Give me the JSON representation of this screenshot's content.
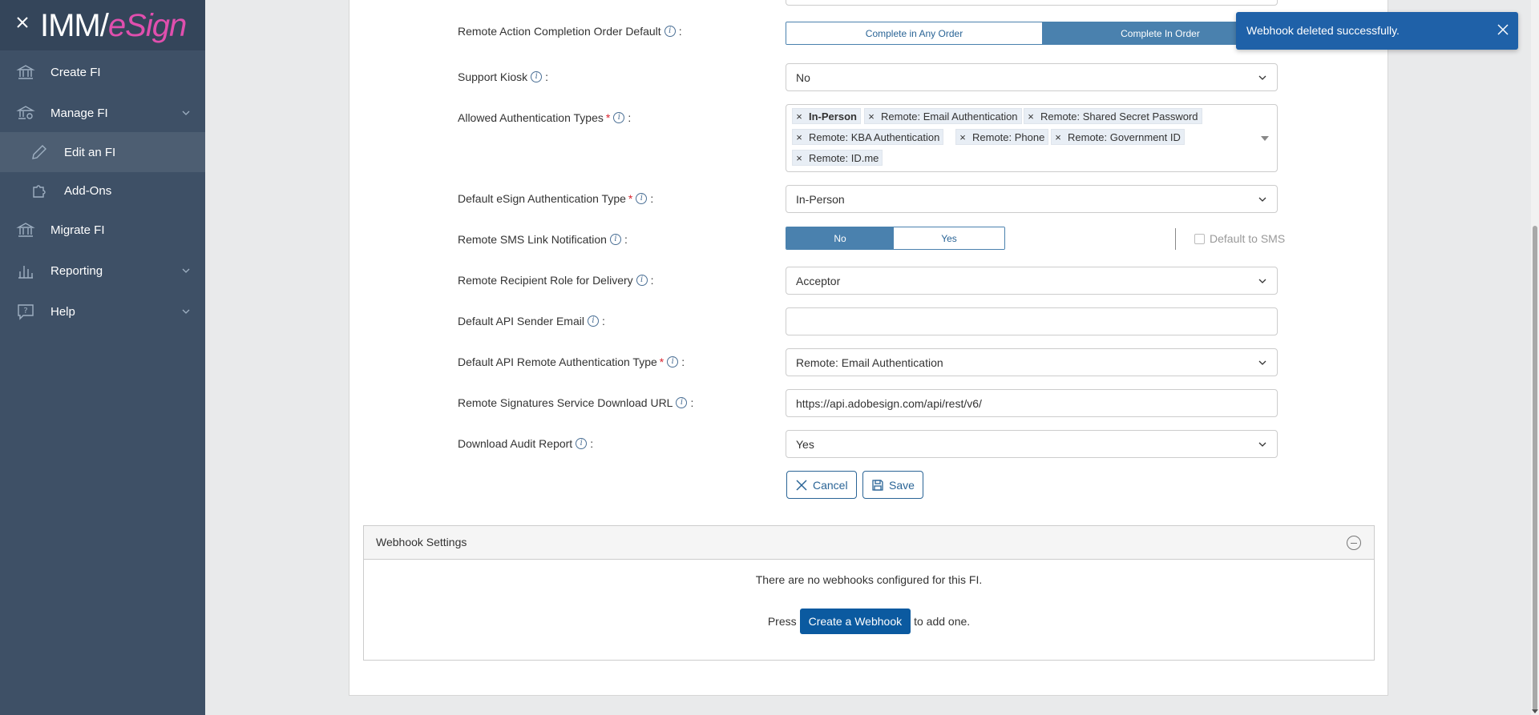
{
  "sidebar": {
    "logo_primary": "IMM",
    "logo_slash": "/",
    "logo_secondary": "eSign",
    "items": [
      {
        "label": "Create FI"
      },
      {
        "label": "Manage FI"
      },
      {
        "label": "Edit an FI"
      },
      {
        "label": "Add-Ons"
      },
      {
        "label": "Migrate FI"
      },
      {
        "label": "Reporting"
      },
      {
        "label": "Help"
      }
    ]
  },
  "form": {
    "completion_order": {
      "label": "Remote Action Completion Order Default",
      "options": [
        "Complete in Any Order",
        "Complete In Order"
      ],
      "selected": "Complete In Order"
    },
    "support_kiosk": {
      "label": "Support Kiosk",
      "value": "No"
    },
    "allowed_auth": {
      "label": "Allowed Authentication Types",
      "tags": [
        "In-Person",
        "Remote: Email Authentication",
        "Remote: Shared Secret Password",
        "Remote: KBA Authentication",
        "Remote: Phone",
        "Remote: Government ID",
        "Remote: ID.me"
      ]
    },
    "default_esign_auth": {
      "label": "Default eSign Authentication Type",
      "value": "In-Person"
    },
    "sms_link": {
      "label": "Remote SMS Link Notification",
      "options": [
        "No",
        "Yes"
      ],
      "selected": "No",
      "default_to_sms_label": "Default to SMS"
    },
    "recipient_role": {
      "label": "Remote Recipient Role for Delivery",
      "value": "Acceptor"
    },
    "api_sender_email": {
      "label": "Default API Sender Email",
      "value": ""
    },
    "api_remote_auth": {
      "label": "Default API Remote Authentication Type",
      "value": "Remote: Email Authentication"
    },
    "download_url": {
      "label": "Remote Signatures Service Download URL",
      "value": "https://api.adobesign.com/api/rest/v6/"
    },
    "audit_report": {
      "label": "Download Audit Report",
      "value": "Yes"
    },
    "cancel_label": "Cancel",
    "save_label": "Save"
  },
  "webhooks": {
    "title": "Webhook Settings",
    "empty_message": "There are no webhooks configured for this FI.",
    "press_label": "Press",
    "create_label": "Create a Webhook",
    "suffix_label": "to add one."
  },
  "toast": {
    "message": "Webhook deleted successfully."
  },
  "colors": {
    "sidebar": "#3e5066",
    "accent": "#4a81ae",
    "toast": "#1f61a8",
    "logo_accent": "#e04fae"
  }
}
